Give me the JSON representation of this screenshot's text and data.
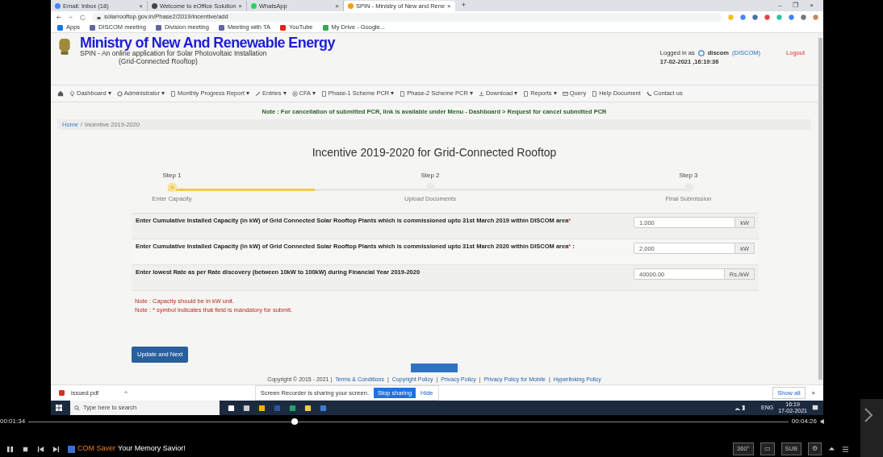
{
  "browser": {
    "tabs": [
      {
        "label": "Email: Inbox (18)",
        "close": "×",
        "selected": false
      },
      {
        "label": "Welcome to eOffice Solution",
        "close": "×",
        "selected": false
      },
      {
        "label": "WhatsApp",
        "close": "×",
        "selected": false
      },
      {
        "label": "SPIN - Ministry of New and Rene",
        "close": "×",
        "selected": true
      }
    ],
    "new_tab": "+",
    "window_controls": [
      "–",
      "❐",
      "×"
    ],
    "address": "solarrooftop.gov.in/Phase2/2019/incentive/add",
    "bookmarks": [
      "Apps",
      "DISCOM meeting",
      "Division meeting",
      "Meeting with TA",
      "YouTube",
      "My Drive - Google..."
    ]
  },
  "site": {
    "title": "Ministry of New And Renewable Energy",
    "subtitle": "SPIN - An online application for Solar Photovoltaic Installation",
    "subtitle_2": "(Grid-Connected Rooftop)",
    "logged_in_label": "Logged in as",
    "user": "discom",
    "role": "(DISCOM)",
    "datetime": "17-02-2021 ,16:19:36",
    "logout": "Logout",
    "nav": [
      {
        "kind": "home"
      },
      {
        "label": "Dashboard ▾",
        "kind": "bulb"
      },
      {
        "label": "Administrator ▾",
        "kind": "gear"
      },
      {
        "label": "Monthly Progress Report ▾",
        "kind": "doc"
      },
      {
        "label": "Entries ▾",
        "kind": "pencil"
      },
      {
        "label": "CFA ▾",
        "kind": "target"
      },
      {
        "label": "Phase-1 Scheme PCR ▾",
        "kind": "doc"
      },
      {
        "label": "Phase-2 Scheme PCR ▾",
        "kind": "doc"
      },
      {
        "label": "Download ▾",
        "kind": "download"
      },
      {
        "label": "Reports ▾",
        "kind": "doc"
      },
      {
        "label": "Query",
        "kind": "mail"
      },
      {
        "label": "Help Document",
        "kind": "doc"
      },
      {
        "label": "Contact us",
        "kind": "phone"
      }
    ],
    "note": "Note : For cancellation of submitted PCR, link is available under Menu - Dashboard > Request for cancel submitted PCR",
    "breadcrumb": [
      {
        "label": "Home",
        "separator": "/"
      },
      {
        "label": "Incentive 2019-2020"
      }
    ],
    "heading": "Incentive 2019-2020 for Grid-Connected Rooftop",
    "progress": {
      "level": 0.28
    },
    "steps": [
      {
        "title": "Step 1",
        "caption": "Enter Capacity",
        "selected": true
      },
      {
        "title": "Step 2",
        "caption": "Upload Documents",
        "selected": false
      },
      {
        "title": "Step 3",
        "caption": "Final Submission",
        "selected": false
      }
    ],
    "fields": [
      {
        "label": "Enter Cumulative Installed Capacity (in kW) of Grid Connected Solar Rooftop Plants which is commissioned upto 31st March 2019 within DISCOM area",
        "required": true,
        "value": "1.000",
        "unit": "kW"
      },
      {
        "label": "Enter Cumulative Installed Capacity (in kW) of Grid Connected Solar Rooftop Plants which is commissioned upto 31st March 2020 within DISCOM area",
        "required": true,
        "suffix": ":",
        "value": "2.000",
        "unit": "kW"
      },
      {
        "label": "Enter lowest Rate as per Rate discovery (between 10kW to 100kW) during Financial Year 2019-2020",
        "required": false,
        "value": "40000.00",
        "unit": "Rs./kW"
      }
    ],
    "notes": [
      "Note : Capacity should be in kW unit.",
      "Note : * symbol indicates that field is mandatory for submit."
    ],
    "required_mark": "*",
    "submit": "Update and Next",
    "footer": "Copyright © 2015 - 2021 |",
    "footer_links": [
      {
        "label": "Terms & Conditions",
        "separator": "|"
      },
      {
        "label": "Copyright Policy",
        "separator": "|"
      },
      {
        "label": "Privacy Policy",
        "separator": "|"
      },
      {
        "label": "Privacy Policy for Mobile",
        "separator": "|"
      },
      {
        "label": "Hyperlinking Policy"
      }
    ]
  },
  "downloads": {
    "file": "issued.pdf",
    "caret": "^",
    "sharing": "Screen Recorder is sharing your screen.",
    "stop": "Stop sharing",
    "hide": "Hide",
    "show_all": "Show all",
    "close": "×"
  },
  "taskbar": {
    "search_placeholder": "Type here to search",
    "lang": "ENG",
    "time": "16:19",
    "date": "17-02-2021"
  },
  "player": {
    "elapsed": "00:01:34",
    "level": 0.35,
    "total": "00:04:26",
    "ad_brand": "COM Saver",
    "ad_text": "Your Memory Savior!",
    "buttons": [
      "360°",
      "▭",
      "SUB",
      "⚙"
    ]
  }
}
